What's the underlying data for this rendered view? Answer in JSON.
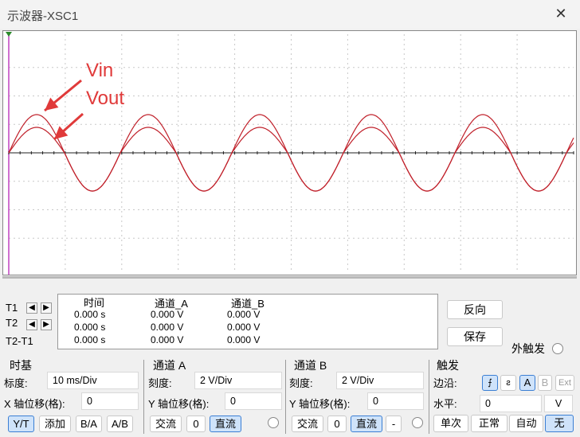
{
  "window": {
    "title": "示波器-XSC1",
    "close_icon": "close-icon"
  },
  "annotations": {
    "vin": "Vin",
    "vout": "Vout",
    "color": "#e03a3a"
  },
  "trace_color": "#c0202a",
  "cursors": {
    "t1_label": "T1",
    "t2_label": "T2",
    "t2t1_label": "T2-T1"
  },
  "readout": {
    "headers": [
      "时间",
      "通道_A",
      "通道_B"
    ],
    "rows": [
      [
        "0.000 s",
        "0.000 V",
        "0.000 V"
      ],
      [
        "0.000 s",
        "0.000 V",
        "0.000 V"
      ],
      [
        "0.000 s",
        "0.000 V",
        "0.000 V"
      ]
    ]
  },
  "actions": {
    "reverse": "反向",
    "save": "保存",
    "ext_trigger": "外触发"
  },
  "timebase": {
    "title": "时基",
    "scale_label": "标度:",
    "scale_value": "10 ms/Div",
    "xpos_label": "X 轴位移(格):",
    "xpos_value": "0",
    "modes": [
      "Y/T",
      "添加",
      "B/A",
      "A/B"
    ],
    "selected_mode": "Y/T"
  },
  "channel_a": {
    "title": "通道 A",
    "scale_label": "刻度:",
    "scale_value": "2  V/Div",
    "ypos_label": "Y 轴位移(格):",
    "ypos_value": "0",
    "ac": "交流",
    "zero": "0",
    "dc": "直流"
  },
  "channel_b": {
    "title": "通道 B",
    "scale_label": "刻度:",
    "scale_value": "2  V/Div",
    "ypos_label": "Y 轴位移(格):",
    "ypos_value": "0",
    "ac": "交流",
    "zero": "0",
    "dc": "直流",
    "minus": "-"
  },
  "trigger": {
    "title": "触发",
    "edge_label": "边沿:",
    "level_label": "水平:",
    "level_value": "0",
    "level_unit": "V",
    "sources": [
      "A",
      "B",
      "Ext"
    ],
    "modes": [
      "单次",
      "正常",
      "自动",
      "无"
    ],
    "selected_mode": "无"
  }
}
